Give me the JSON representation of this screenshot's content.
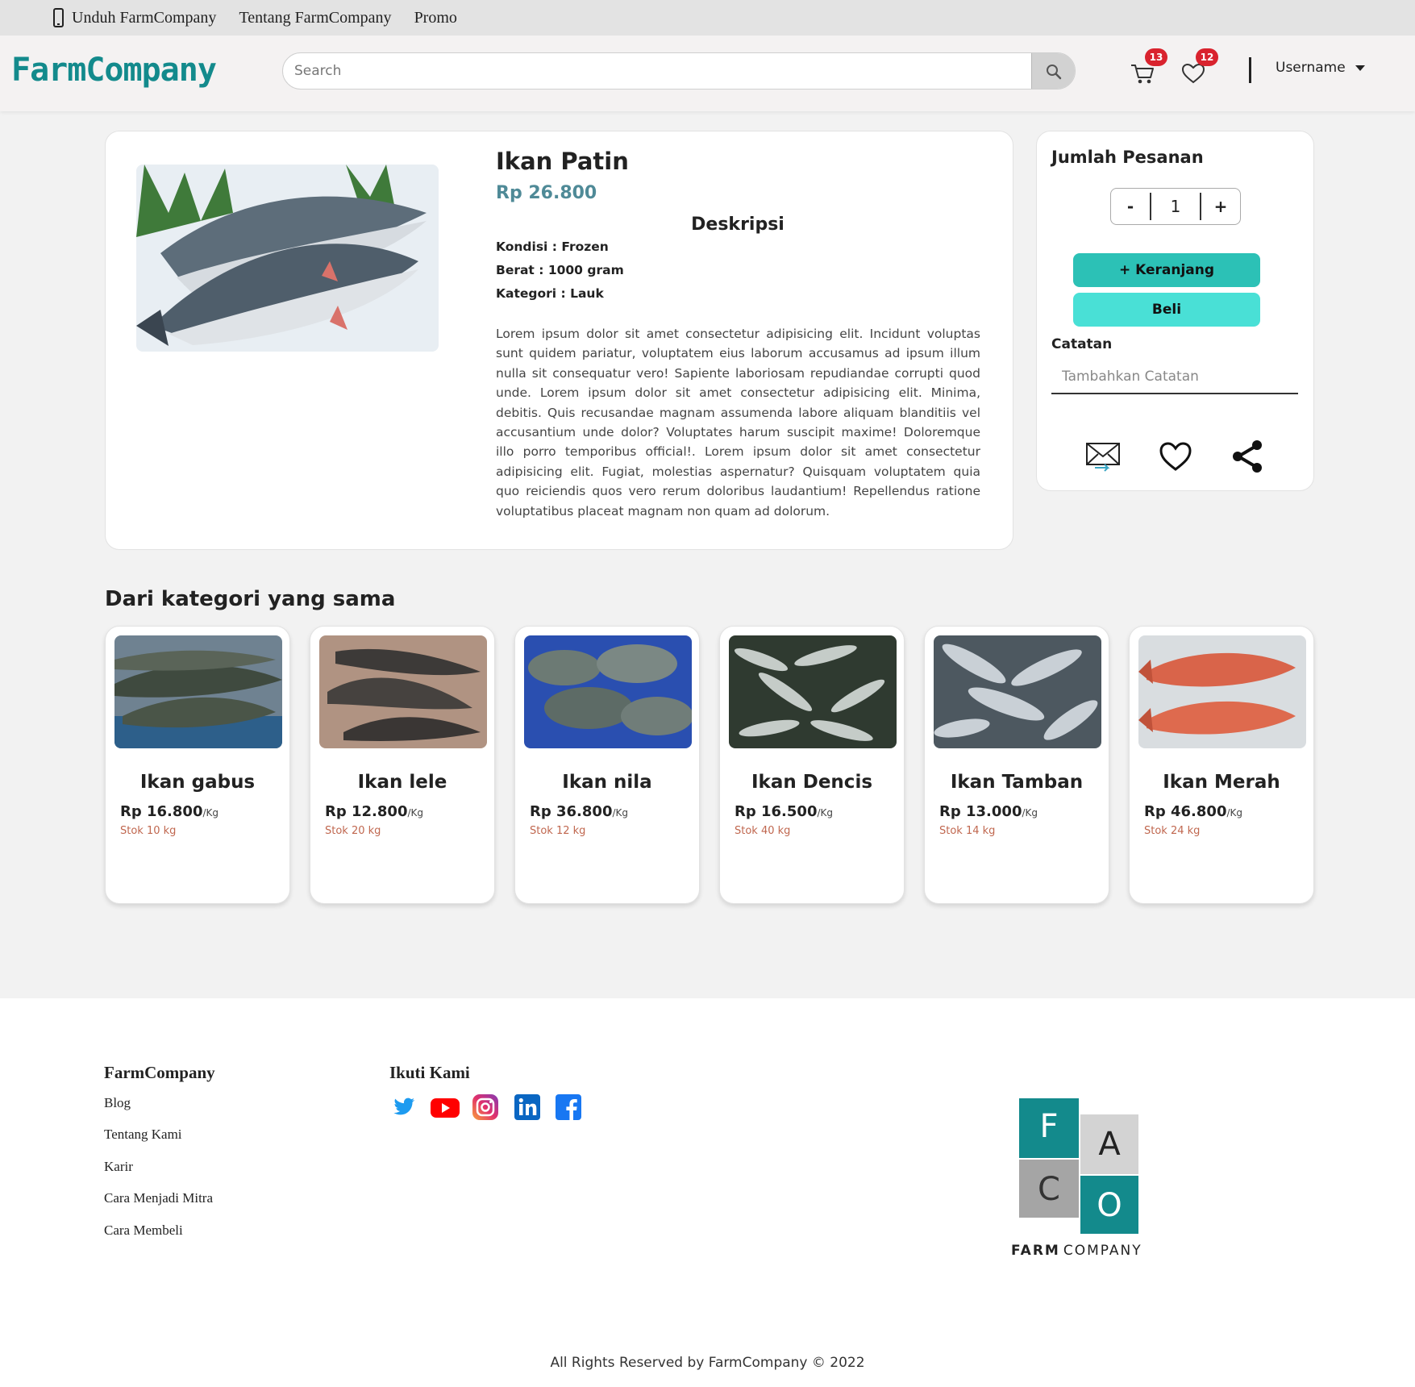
{
  "topbar": {
    "items": [
      {
        "label": "Unduh FarmCompany",
        "icon": "phone-icon"
      },
      {
        "label": "Tentang FarmCompany"
      },
      {
        "label": "Promo"
      }
    ]
  },
  "header": {
    "logo": "FarmCompany",
    "search_placeholder": "Search",
    "cart_count": "13",
    "wishlist_count": "12",
    "username": "Username"
  },
  "product": {
    "name": "Ikan Patin",
    "price": "Rp 26.800",
    "description_title": "Deskripsi",
    "kondisi": "Kondisi : Frozen",
    "berat": "Berat : 1000 gram",
    "kategori": "Kategori : Lauk",
    "description": "Lorem ipsum dolor sit amet consectetur adipisicing elit. Incidunt voluptas sunt quidem pariatur, voluptatem eius laborum accusamus ad ipsum illum nulla sit consequatur vero! Sapiente laboriosam repudiandae corrupti quod unde. Lorem ipsum dolor sit amet consectetur adipisicing elit. Minima, debitis. Quis recusandae magnam assumenda labore aliquam blanditiis vel accusantium unde dolor? Voluptates harum suscipit maxime! Doloremque illo porro temporibus official!. Lorem ipsum dolor sit amet consectetur adipisicing elit. Fugiat, molestias aspernatur? Quisquam voluptatem quia quo reiciendis quos vero rerum doloribus laudantium! Repellendus ratione voluptatibus placeat magnam non quam ad dolorum."
  },
  "order": {
    "title": "Jumlah Pesanan",
    "minus": "-",
    "quantity": "1",
    "plus": "+",
    "add_to_cart": "+ Keranjang",
    "buy": "Beli",
    "note_label": "Catatan",
    "note_placeholder": "Tambahkan Catatan",
    "icons": [
      "mail-icon",
      "heart-icon",
      "share-icon"
    ]
  },
  "related": {
    "title": "Dari kategori yang sama",
    "items": [
      {
        "name": "Ikan gabus",
        "price": "Rp 16.800",
        "unit": "/Kg",
        "stock": "Stok 10 kg"
      },
      {
        "name": "Ikan lele",
        "price": "Rp 12.800",
        "unit": "/Kg",
        "stock": "Stok 20 kg"
      },
      {
        "name": "Ikan nila",
        "price": "Rp 36.800",
        "unit": "/Kg",
        "stock": "Stok 12 kg"
      },
      {
        "name": "Ikan Dencis",
        "price": "Rp 16.500",
        "unit": "/Kg",
        "stock": "Stok 40 kg"
      },
      {
        "name": "Ikan Tamban",
        "price": "Rp 13.000",
        "unit": "/Kg",
        "stock": "Stok 14 kg"
      },
      {
        "name": "Ikan Merah",
        "price": "Rp 46.800",
        "unit": "/Kg",
        "stock": "Stok 24 kg"
      }
    ]
  },
  "footer": {
    "brand": "FarmCompany",
    "links": [
      "Blog",
      "Tentang Kami",
      "Karir",
      "Cara Menjadi Mitra",
      "Cara Membeli"
    ],
    "follow_title": "Ikuti Kami",
    "social": [
      "twitter-icon",
      "youtube-icon",
      "instagram-icon",
      "linkedin-icon",
      "facebook-icon"
    ],
    "logo_letters": [
      "F",
      "A",
      "C",
      "O"
    ],
    "logo_text_bold": "FARM",
    "logo_text_rest": "COMPANY",
    "copyright": "All Rights Reserved by FarmCompany © 2022"
  },
  "colors": {
    "brand_teal": "#138a8c",
    "price_teal": "#4f8a97",
    "cart_button": "#2cc1b6",
    "buy_button": "#49e0d6",
    "badge_red": "#d9232e",
    "stock_text": "#c0674f"
  }
}
